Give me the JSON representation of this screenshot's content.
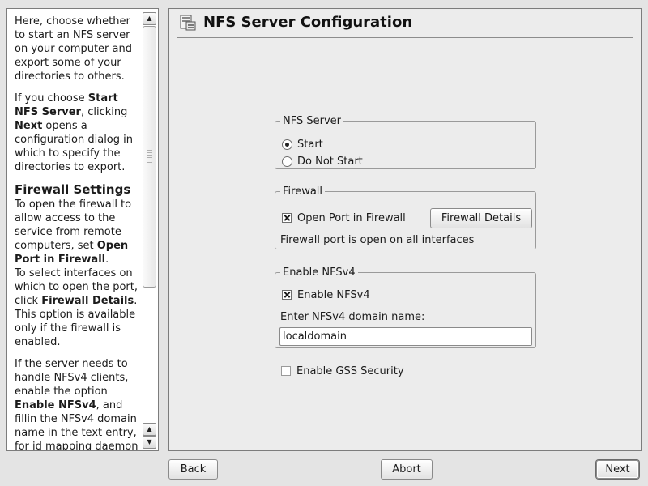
{
  "help": {
    "p1": "Here, choose whether to start an NFS server on your computer and export some of your directories to others.",
    "p2_a": "If you choose ",
    "p2_b": "Start NFS Server",
    "p2_c": ", clicking ",
    "p2_d": "Next",
    "p2_e": " opens a configuration dialog in which to specify the directories to export.",
    "h_firewall": "Firewall Settings",
    "p3_a": "To open the firewall to allow access to the service from remote computers, set ",
    "p3_b": "Open Port in Firewall",
    "p3_c": ".",
    "p4_a": "To select interfaces on which to open the port, click ",
    "p4_b": "Firewall Details",
    "p4_c": ". This option is available only if the firewall is enabled.",
    "p5_a": "If the server needs to handle NFSv4 clients, enable the option ",
    "p5_b": "Enable NFSv4",
    "p5_c": ", and fillin the NFSv4 domain name in the text entry, for id mapping daemon"
  },
  "header": {
    "title": "NFS Server Configuration",
    "icon": "nfs-server-icon"
  },
  "nfs_server": {
    "legend": "NFS Server",
    "start_label": "Start",
    "do_not_start_label": "Do Not Start",
    "selected": "Start"
  },
  "firewall": {
    "legend": "Firewall",
    "open_port_label": "Open Port in Firewall",
    "open_port_checked": true,
    "details_button": "Firewall Details",
    "status_text": "Firewall port is open on all interfaces"
  },
  "nfsv4": {
    "legend": "Enable NFSv4",
    "enable_label": "Enable NFSv4",
    "enable_checked": true,
    "domain_label": "Enter NFSv4 domain name:",
    "domain_value": "localdomain"
  },
  "gss": {
    "label": "Enable GSS Security",
    "checked": false
  },
  "footer": {
    "back": "Back",
    "abort": "Abort",
    "next": "Next"
  }
}
